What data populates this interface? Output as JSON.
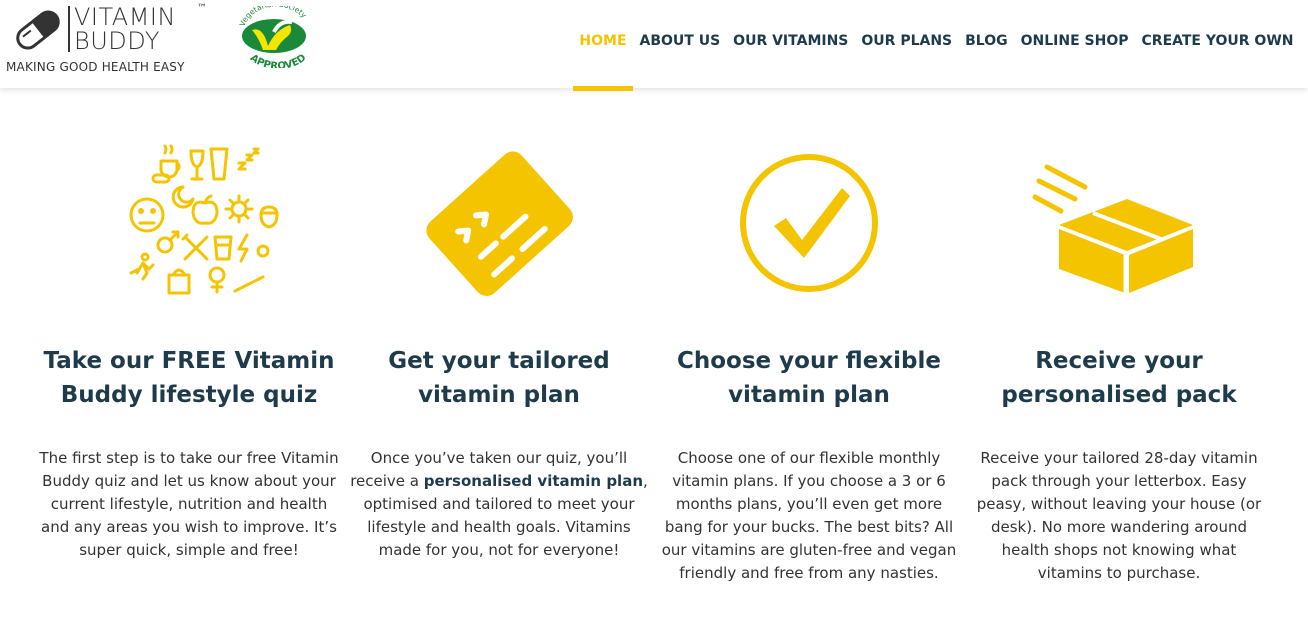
{
  "header": {
    "brand_line1": "VITAMIN",
    "brand_line2": "BUDDY",
    "trademark": "™",
    "tagline": "MAKING GOOD HEALTH EASY",
    "badge_top": "Vegetarian Society",
    "badge_bottom": "APPROVED"
  },
  "nav": {
    "items": [
      {
        "label": "HOME",
        "active": true
      },
      {
        "label": "ABOUT US"
      },
      {
        "label": "OUR VITAMINS"
      },
      {
        "label": "OUR PLANS"
      },
      {
        "label": "BLOG"
      },
      {
        "label": "ONLINE SHOP"
      },
      {
        "label": "CREATE YOUR OWN"
      }
    ]
  },
  "colors": {
    "accent": "#f5c400",
    "heading": "#1d3b4a",
    "text": "#333333",
    "badge_green": "#1a8a3a"
  },
  "steps": [
    {
      "icon": "lifestyle-icons-cluster",
      "title": "Take our FREE Vitamin Buddy lifestyle quiz",
      "text": "The first step is to take our free Vitamin Buddy quiz and let us know about your current lifestyle, nutrition and health and any areas you wish to improve. It’s super quick, simple and free!"
    },
    {
      "icon": "vitamin-plan-card-icon",
      "title": "Get your tailored vitamin plan",
      "text_before": "Once you’ve taken our quiz, you’ll receive a ",
      "text_bold": "personalised vitamin plan",
      "text_after": ", optimised and tailored to meet your lifestyle and health goals. Vitamins made for you, not for everyone!"
    },
    {
      "icon": "checkmark-circle-icon",
      "title": "Choose your flexible vitamin plan",
      "text": "Choose one of our flexible monthly vitamin plans. If you choose a 3 or 6 months plans, you’ll even get more bang for your bucks. The best bits? All our vitamins are gluten-free and vegan friendly and free from any nasties."
    },
    {
      "icon": "delivery-box-icon",
      "title": "Receive your personalised pack",
      "text": "Receive your tailored 28-day vitamin pack through your letterbox. Easy peasy, without leaving your house (or desk). No more wandering around health shops not knowing what vitamins to purchase."
    }
  ]
}
